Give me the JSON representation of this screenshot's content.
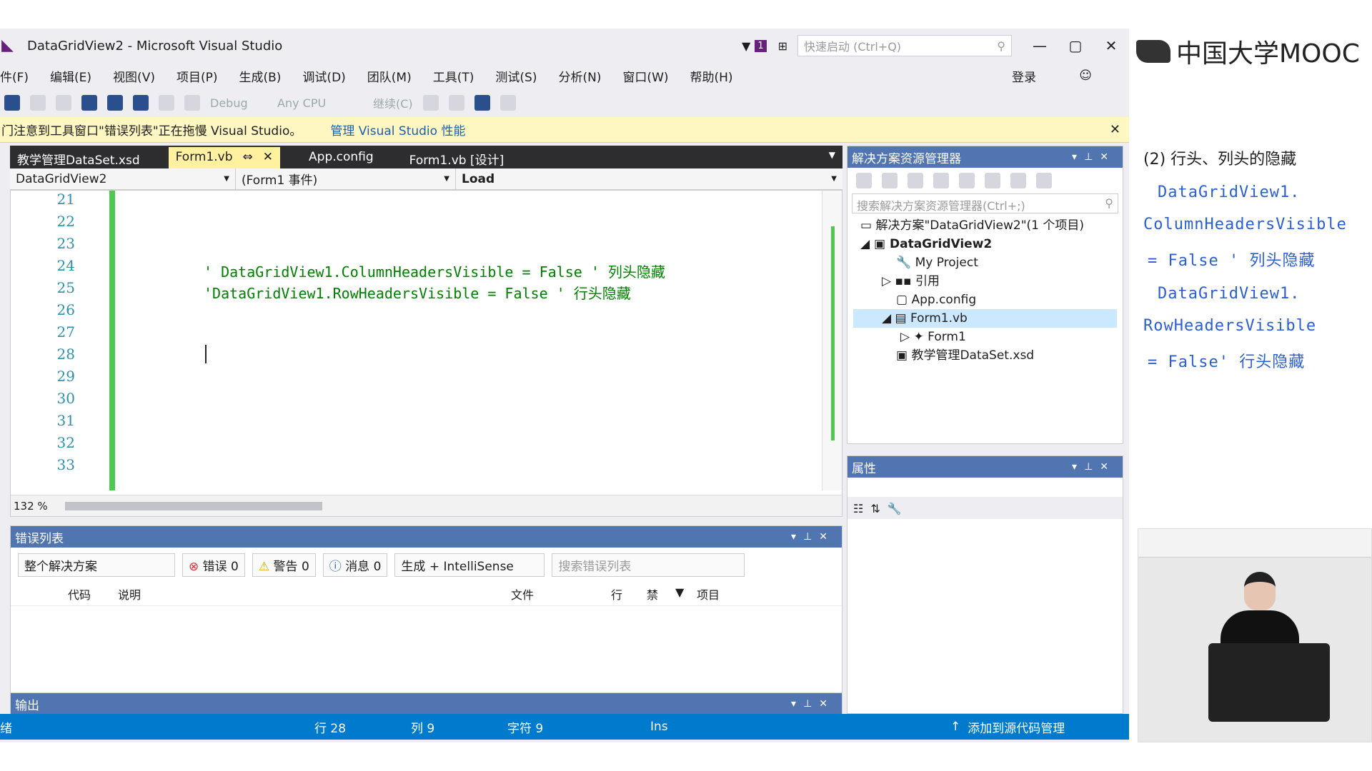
{
  "window": {
    "title": "DataGridView2 - Microsoft Visual Studio",
    "quick_launch_placeholder": "快速启动 (Ctrl+Q)",
    "notify_count": "1"
  },
  "menu": [
    "件(F)",
    "编辑(E)",
    "视图(V)",
    "项目(P)",
    "生成(B)",
    "调试(D)",
    "团队(M)",
    "工具(T)",
    "测试(S)",
    "分析(N)",
    "窗口(W)",
    "帮助(H)"
  ],
  "login": "登录",
  "toolbar": {
    "config": "Debug",
    "platform": "Any CPU",
    "continue": "继续(C)"
  },
  "infobar": {
    "message": "门注意到工具窗口\"错误列表\"正在拖慢 Visual Studio。",
    "link": "管理 Visual Studio 性能"
  },
  "tabs": [
    {
      "label": "教学管理DataSet.xsd"
    },
    {
      "label": "Form1.vb",
      "active": true
    },
    {
      "label": "App.config"
    },
    {
      "label": "Form1.vb [设计]"
    }
  ],
  "nav": {
    "class": "DataGridView2",
    "events": "(Form1 事件)",
    "method": "Load"
  },
  "editor": {
    "lines": [
      "21",
      "22",
      "23",
      "24",
      "25",
      "26",
      "27",
      "28",
      "29",
      "30",
      "31",
      "32",
      "33"
    ],
    "code": [
      "' DataGridView1.ColumnHeadersVisible = False ' 列头隐藏",
      "'DataGridView1.RowHeadersVisible = False ' 行头隐藏"
    ],
    "zoom": "132 %"
  },
  "error_list": {
    "title": "错误列表",
    "scope": "整个解决方案",
    "errors": "错误 0",
    "warnings": "警告 0",
    "messages": "消息 0",
    "build": "生成 + IntelliSense",
    "search": "搜索错误列表",
    "cols": [
      "代码",
      "说明",
      "文件",
      "行",
      "禁",
      "项目"
    ]
  },
  "output": {
    "title": "输出"
  },
  "solution": {
    "title": "解决方案资源管理器",
    "search": "搜索解决方案资源管理器(Ctrl+;)",
    "items": [
      "解决方案\"DataGridView2\"(1 个项目)",
      "DataGridView2",
      "My Project",
      "引用",
      "App.config",
      "Form1.vb",
      "Form1",
      "教学管理DataSet.xsd"
    ]
  },
  "properties": {
    "title": "属性"
  },
  "status": {
    "left": "绪",
    "line": "行 28",
    "col": "列 9",
    "char": "字符 9",
    "mode": "Ins",
    "source": "添加到源代码管理"
  },
  "mooc": "中国大学MOOC",
  "notes": [
    "(2) 行头、列头的隐藏",
    "DataGridView1.",
    "ColumnHeadersVisible",
    " = False ' 列头隐藏",
    "DataGridView1.",
    "RowHeadersVisible",
    " = False' 行头隐藏"
  ],
  "colors": {
    "accent": "#007acc",
    "tab_active": "#fff1a0",
    "comment": "#008000"
  }
}
